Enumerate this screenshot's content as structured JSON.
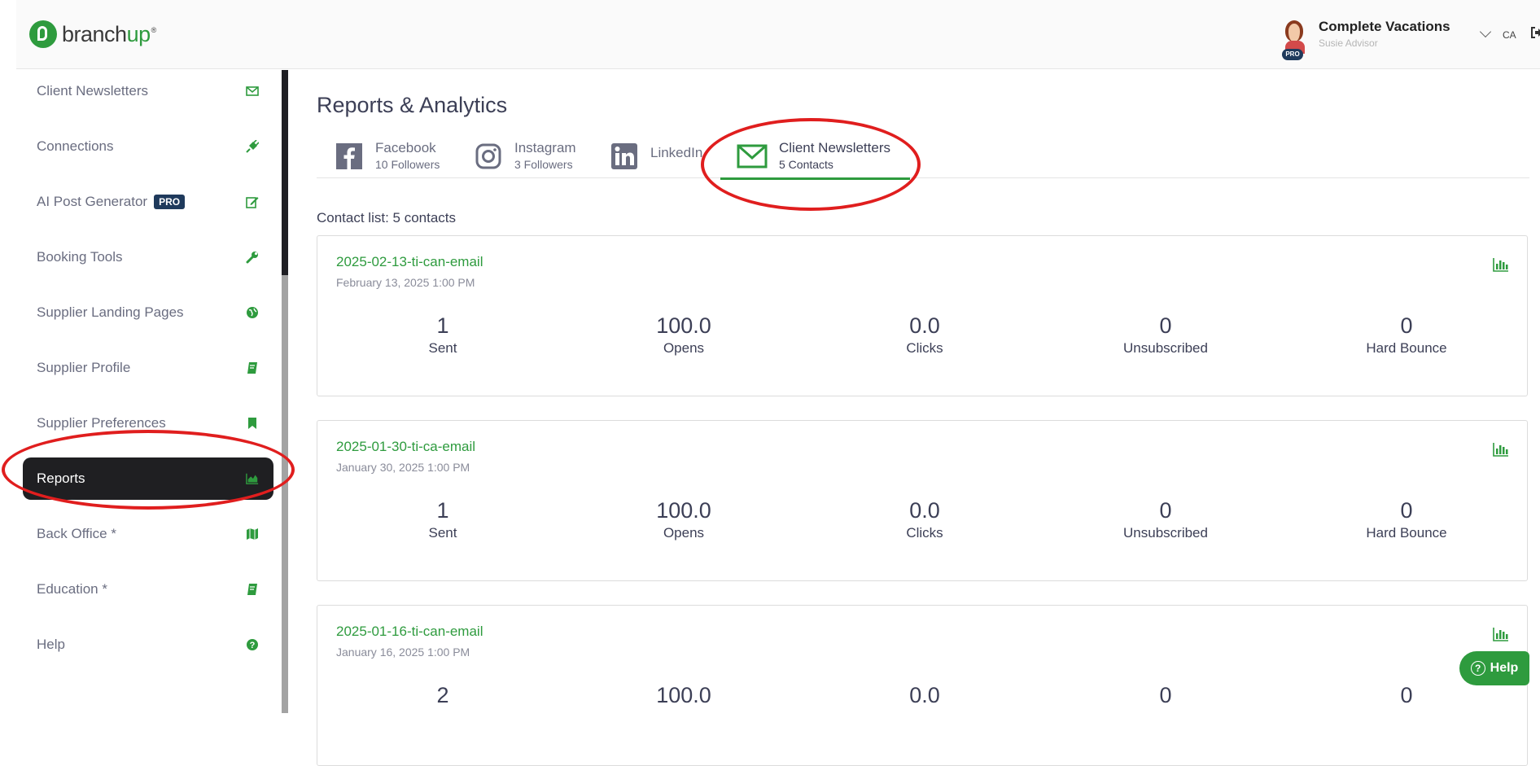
{
  "header": {
    "logo_text_branch": "branch",
    "logo_text_up": "up",
    "logo_tm": "®",
    "account_name": "Complete Vacations",
    "account_role": "Susie Advisor",
    "avatar_badge": "PRO",
    "language": "CA"
  },
  "sidebar": {
    "items": [
      {
        "label": "Client Newsletters",
        "icon": "envelope-icon"
      },
      {
        "label": "Connections",
        "icon": "plug-icon"
      },
      {
        "label": "AI Post Generator",
        "badge": "PRO",
        "icon": "edit-icon"
      },
      {
        "label": "Booking Tools",
        "icon": "wrench-icon"
      },
      {
        "label": "Supplier Landing Pages",
        "icon": "globe-icon"
      },
      {
        "label": "Supplier Profile",
        "icon": "book-icon"
      },
      {
        "label": "Supplier Preferences",
        "icon": "bookmark-icon"
      },
      {
        "label": "Reports",
        "icon": "area-chart-icon",
        "active": true
      },
      {
        "label": "Back Office *",
        "icon": "map-icon"
      },
      {
        "label": "Education *",
        "icon": "book-icon"
      },
      {
        "label": "Help",
        "icon": "question-circle-icon"
      }
    ]
  },
  "main": {
    "title": "Reports & Analytics",
    "tabs": [
      {
        "name": "Facebook",
        "sub": "10 Followers",
        "icon": "facebook-icon"
      },
      {
        "name": "Instagram",
        "sub": "3 Followers",
        "icon": "instagram-icon"
      },
      {
        "name": "LinkedIn",
        "sub": "",
        "icon": "linkedin-icon"
      },
      {
        "name": "Client Newsletters",
        "sub": "5 Contacts",
        "icon": "envelope-icon",
        "active": true
      }
    ],
    "contact_list": "Contact list: 5 contacts",
    "stat_labels": [
      "Sent",
      "Opens",
      "Clicks",
      "Unsubscribed",
      "Hard Bounce"
    ],
    "cards": [
      {
        "title": "2025-02-13-ti-can-email",
        "date": "February 13, 2025 1:00 PM",
        "values": [
          "1",
          "100.0",
          "0.0",
          "0",
          "0"
        ]
      },
      {
        "title": "2025-01-30-ti-ca-email",
        "date": "January 30, 2025 1:00 PM",
        "values": [
          "1",
          "100.0",
          "0.0",
          "0",
          "0"
        ]
      },
      {
        "title": "2025-01-16-ti-can-email",
        "date": "January 16, 2025 1:00 PM",
        "values": [
          "2",
          "100.0",
          "0.0",
          "0",
          "0"
        ]
      }
    ]
  },
  "help_button": "Help",
  "colors": {
    "accent": "#2e9b3e",
    "annotation": "#e01e1e",
    "active_bg": "#1f1f22"
  }
}
